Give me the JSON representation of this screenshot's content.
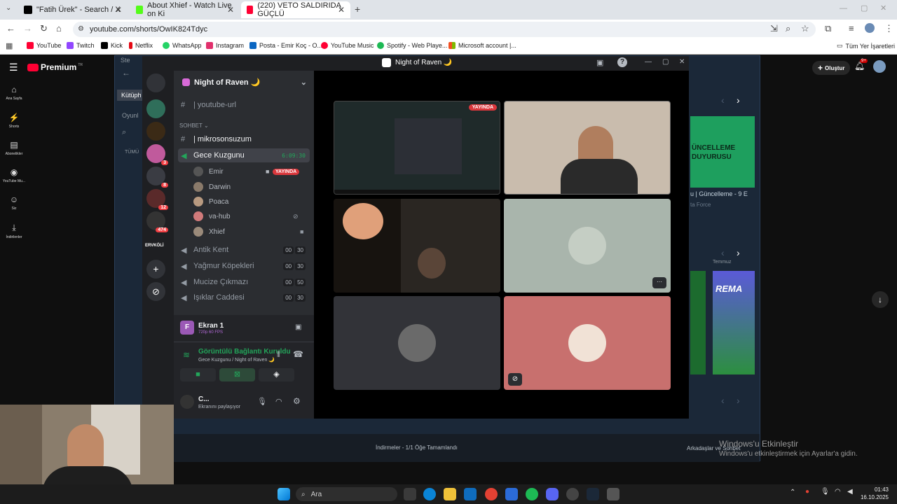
{
  "browser": {
    "tabs": [
      {
        "title": "\"Fatih Ürek\" - Search / X",
        "active": false
      },
      {
        "title": "About Xhief - Watch Live on Ki",
        "active": false
      },
      {
        "title": "(220) VETO SALDIRIDA GÜÇLÜ",
        "active": true
      }
    ],
    "url": "youtube.com/shorts/OwIK824Tdyc",
    "bookmarks": [
      "YouTube",
      "Twitch",
      "Kick",
      "Netflix",
      "WhatsApp",
      "Instagram",
      "Posta - Emir Koç - O...",
      "YouTube Music",
      "Spotify - Web Playe...",
      "Microsoft account |..."
    ],
    "all_bookmarks": "Tüm Yer İşaretleri"
  },
  "youtube": {
    "logo": "Premium",
    "logo_sup": "TR",
    "nav": [
      "Ana Sayfa",
      "Shorts",
      "Abonelikler",
      "YouTube Mu...",
      "Siz",
      "İndirilenler"
    ],
    "create_label": "Oluştur",
    "notif_count": "9+",
    "library_tab": "Kütüph",
    "games_tab": "Oyunl",
    "all_label": "TÜMÜ",
    "banner_line1": "ÜNCELLEME",
    "banner_line2": "DUYURUSU",
    "video_title": "u | Güncelleme - 9 E",
    "video_channel": "ta Force",
    "month_label": "Temmuz",
    "card_text": "REMA",
    "downloads_status": "İndirmeler - 1/1 Öğe Tamamlandı",
    "friends_chat": "Arkadaşlar ve Sohbet",
    "steam_label": "Ste"
  },
  "discord": {
    "window_title": "Night of Raven 🌙",
    "server_name": "Night of Raven 🌙",
    "channels": {
      "top_text": "| youtube-url",
      "category": "SOHBET",
      "mikro": "| mikrosonsuzum",
      "active_voice": "Gece Kuzgunu",
      "active_timer": "6:09:30",
      "others": [
        {
          "name": "Antik Kent",
          "a": "00",
          "b": "30"
        },
        {
          "name": "Yağmur Köpekleri",
          "a": "00",
          "b": "30"
        },
        {
          "name": "Mucize Çıkmazı",
          "a": "00",
          "b": "50"
        },
        {
          "name": "Işıklar Caddesi",
          "a": "00",
          "b": "30"
        }
      ]
    },
    "users": [
      "Emir",
      "Darwin",
      "Poaca",
      "va-hub",
      "Xhief"
    ],
    "live_label": "YAYINDA",
    "server_badges": [
      "3",
      "8",
      "12",
      "474"
    ],
    "server_label": "ERVKÖLİ",
    "panel": {
      "screen_title": "Ekran 1",
      "screen_sub": "720p 60 FPS",
      "conn_title": "Görüntülü Bağlantı Kuruldu",
      "conn_sub": "Gece Kuzgunu / Night of Raven 🌙",
      "user_name": "C...",
      "user_status": "Ekranını paylaşıyor"
    },
    "tile_live": "YAYINDA",
    "tile_more": "···"
  },
  "windows": {
    "search_placeholder": "Ara",
    "time": "01:43",
    "date": "16.10.2025",
    "activate_title": "Windows'u Etkinleştir",
    "activate_sub": "Windows'u etkinleştirmek için Ayarlar'a gidin."
  }
}
